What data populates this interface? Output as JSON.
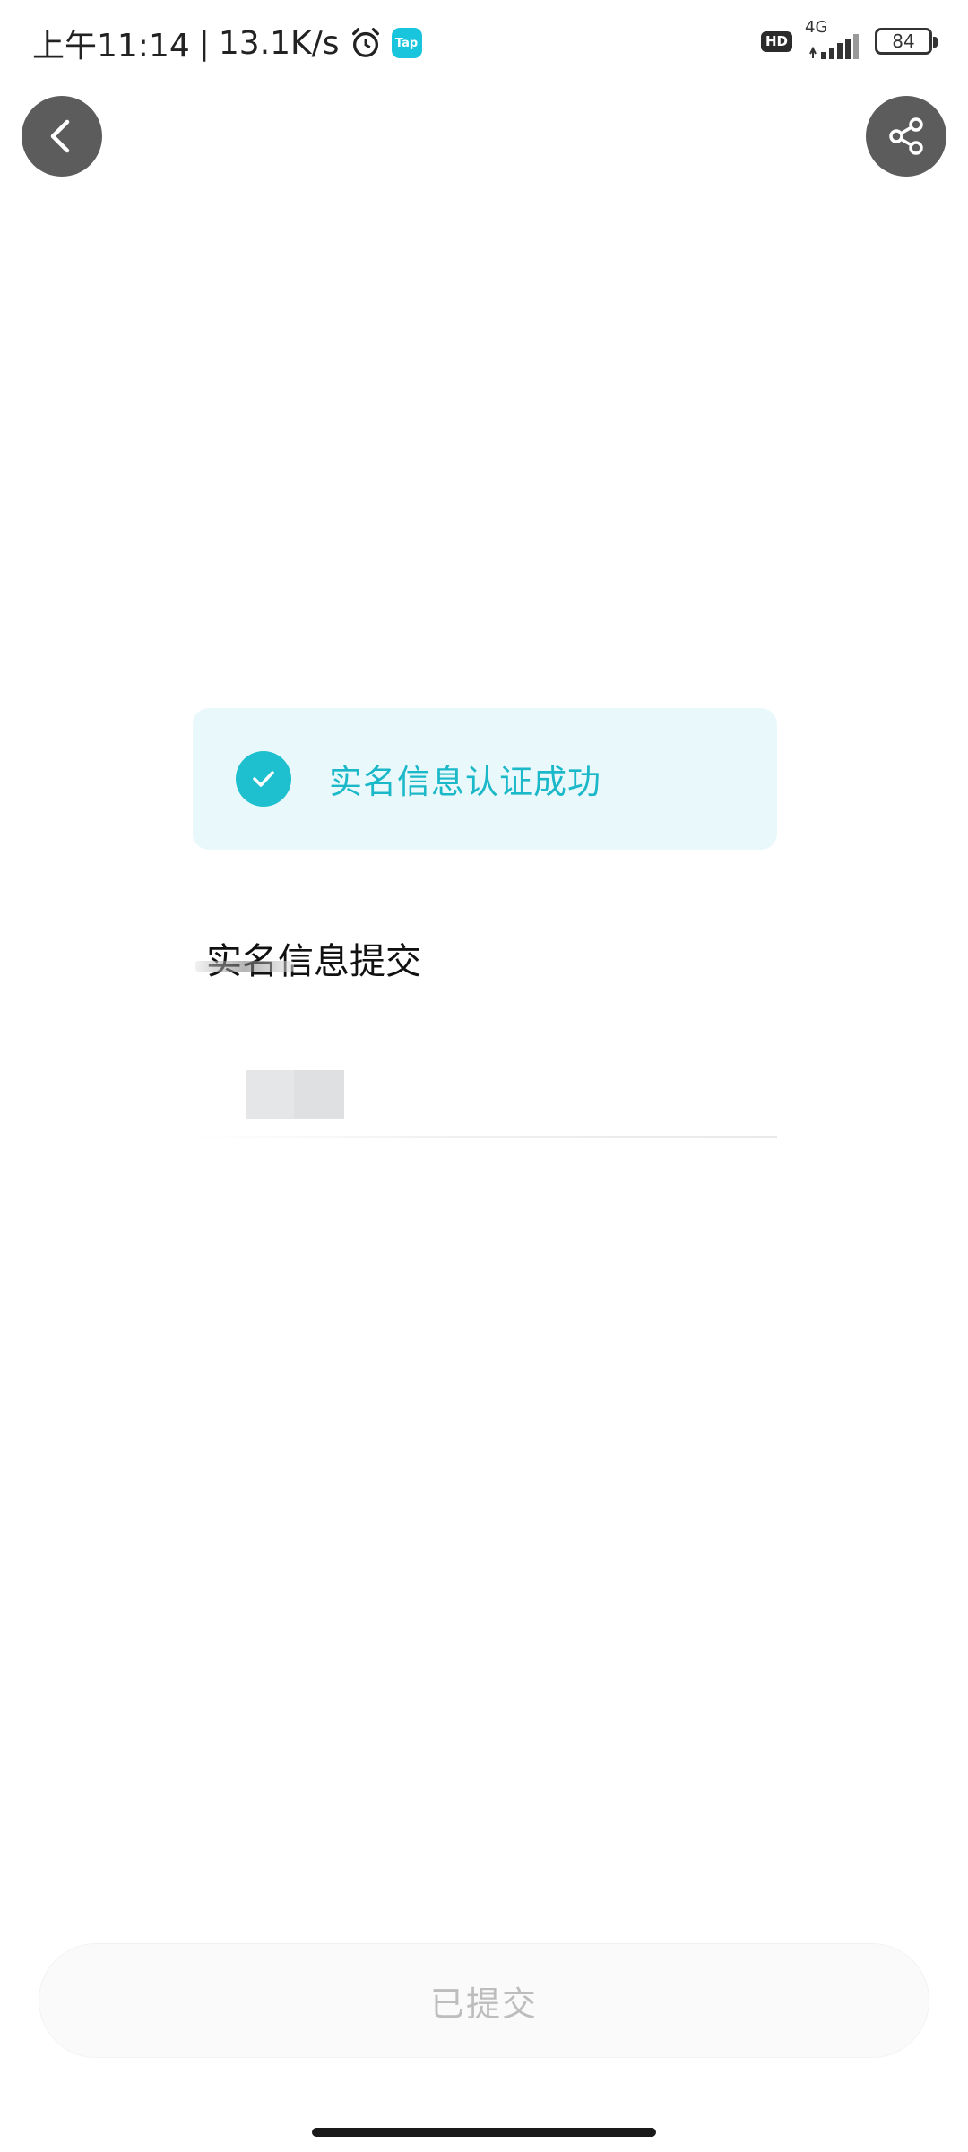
{
  "status_bar": {
    "time": "上午11:14",
    "net_speed": "13.1K/s",
    "tap_label": "Tap",
    "hd_label": "HD",
    "network_type": "4G",
    "battery_level": "84"
  },
  "header": {
    "back_icon": "chevron-left-icon",
    "share_icon": "share-icon"
  },
  "success_banner": {
    "text": "实名信息认证成功",
    "accent_color": "#1ec0cf"
  },
  "section": {
    "title": "实名信息提交"
  },
  "footer": {
    "button_label": "已提交"
  }
}
